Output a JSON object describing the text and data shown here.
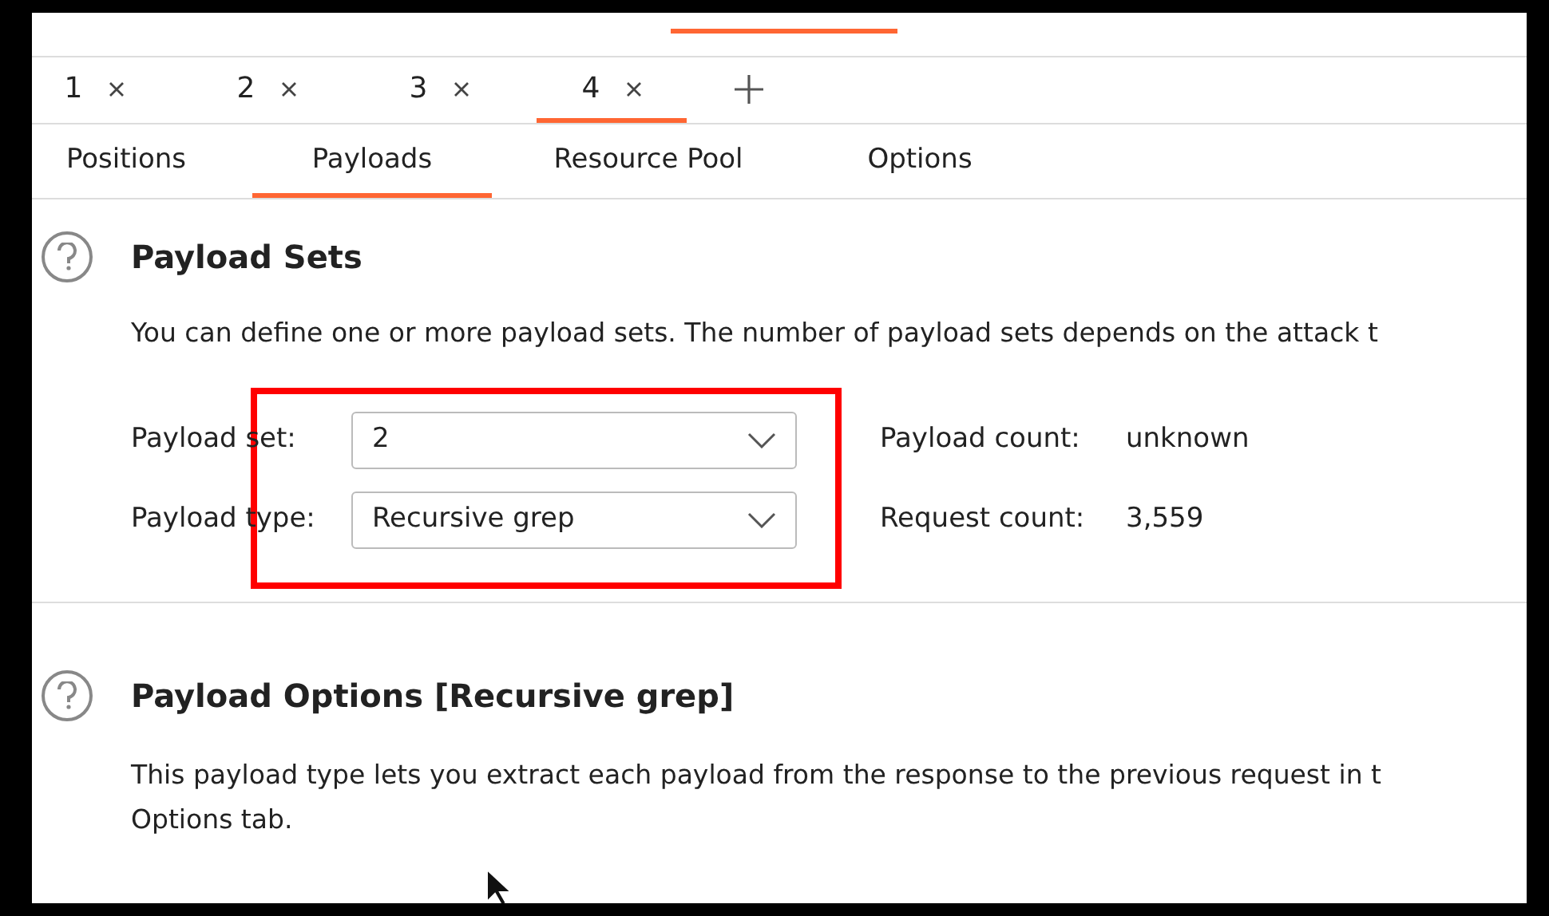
{
  "top_tabs": [
    {
      "label": "1",
      "selected": false
    },
    {
      "label": "2",
      "selected": false
    },
    {
      "label": "3",
      "selected": false
    },
    {
      "label": "4",
      "selected": true
    }
  ],
  "sub_tabs": [
    {
      "label": "Positions",
      "selected": false
    },
    {
      "label": "Payloads",
      "selected": true
    },
    {
      "label": "Resource Pool",
      "selected": false
    },
    {
      "label": "Options",
      "selected": false
    }
  ],
  "payload_sets": {
    "title": "Payload Sets",
    "description": "You can define one or more payload sets. The number of payload sets depends on the attack t",
    "highlighted": true,
    "fields": [
      {
        "label": "Payload set:",
        "value": "2",
        "info_label": "Payload count:",
        "info_value": "unknown"
      },
      {
        "label": "Payload type:",
        "value": "Recursive grep",
        "info_label": "Request count:",
        "info_value": "3,559"
      }
    ]
  },
  "payload_options": {
    "title": "Payload Options [Recursive grep]",
    "description_lines": [
      "This payload type lets you extract each payload from the response to the previous request in t",
      "Options tab."
    ]
  }
}
